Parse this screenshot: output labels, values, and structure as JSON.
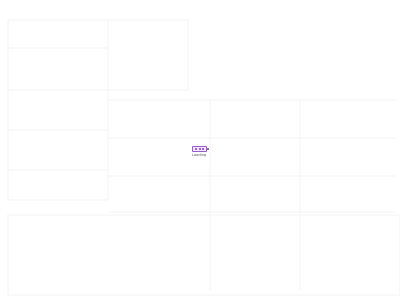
{
  "loader": {
    "label": "Loading",
    "icon": "battery-loading-icon",
    "accent_color": "#9a5ad0",
    "fill_color": "#f3e8ff"
  },
  "background": {
    "color": "#ffffff",
    "line_color": "#f4f4f6"
  }
}
